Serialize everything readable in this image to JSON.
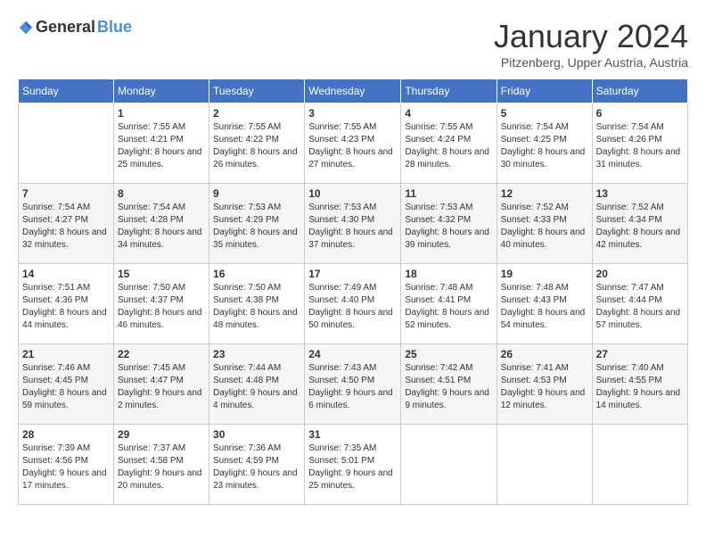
{
  "header": {
    "logo_general": "General",
    "logo_blue": "Blue",
    "month_year": "January 2024",
    "location": "Pitzenberg, Upper Austria, Austria"
  },
  "weekdays": [
    "Sunday",
    "Monday",
    "Tuesday",
    "Wednesday",
    "Thursday",
    "Friday",
    "Saturday"
  ],
  "weeks": [
    [
      {
        "day": "",
        "sunrise": "",
        "sunset": "",
        "daylight": ""
      },
      {
        "day": "1",
        "sunrise": "Sunrise: 7:55 AM",
        "sunset": "Sunset: 4:21 PM",
        "daylight": "Daylight: 8 hours and 25 minutes."
      },
      {
        "day": "2",
        "sunrise": "Sunrise: 7:55 AM",
        "sunset": "Sunset: 4:22 PM",
        "daylight": "Daylight: 8 hours and 26 minutes."
      },
      {
        "day": "3",
        "sunrise": "Sunrise: 7:55 AM",
        "sunset": "Sunset: 4:23 PM",
        "daylight": "Daylight: 8 hours and 27 minutes."
      },
      {
        "day": "4",
        "sunrise": "Sunrise: 7:55 AM",
        "sunset": "Sunset: 4:24 PM",
        "daylight": "Daylight: 8 hours and 28 minutes."
      },
      {
        "day": "5",
        "sunrise": "Sunrise: 7:54 AM",
        "sunset": "Sunset: 4:25 PM",
        "daylight": "Daylight: 8 hours and 30 minutes."
      },
      {
        "day": "6",
        "sunrise": "Sunrise: 7:54 AM",
        "sunset": "Sunset: 4:26 PM",
        "daylight": "Daylight: 8 hours and 31 minutes."
      }
    ],
    [
      {
        "day": "7",
        "sunrise": "Sunrise: 7:54 AM",
        "sunset": "Sunset: 4:27 PM",
        "daylight": "Daylight: 8 hours and 32 minutes."
      },
      {
        "day": "8",
        "sunrise": "Sunrise: 7:54 AM",
        "sunset": "Sunset: 4:28 PM",
        "daylight": "Daylight: 8 hours and 34 minutes."
      },
      {
        "day": "9",
        "sunrise": "Sunrise: 7:53 AM",
        "sunset": "Sunset: 4:29 PM",
        "daylight": "Daylight: 8 hours and 35 minutes."
      },
      {
        "day": "10",
        "sunrise": "Sunrise: 7:53 AM",
        "sunset": "Sunset: 4:30 PM",
        "daylight": "Daylight: 8 hours and 37 minutes."
      },
      {
        "day": "11",
        "sunrise": "Sunrise: 7:53 AM",
        "sunset": "Sunset: 4:32 PM",
        "daylight": "Daylight: 8 hours and 39 minutes."
      },
      {
        "day": "12",
        "sunrise": "Sunrise: 7:52 AM",
        "sunset": "Sunset: 4:33 PM",
        "daylight": "Daylight: 8 hours and 40 minutes."
      },
      {
        "day": "13",
        "sunrise": "Sunrise: 7:52 AM",
        "sunset": "Sunset: 4:34 PM",
        "daylight": "Daylight: 8 hours and 42 minutes."
      }
    ],
    [
      {
        "day": "14",
        "sunrise": "Sunrise: 7:51 AM",
        "sunset": "Sunset: 4:36 PM",
        "daylight": "Daylight: 8 hours and 44 minutes."
      },
      {
        "day": "15",
        "sunrise": "Sunrise: 7:50 AM",
        "sunset": "Sunset: 4:37 PM",
        "daylight": "Daylight: 8 hours and 46 minutes."
      },
      {
        "day": "16",
        "sunrise": "Sunrise: 7:50 AM",
        "sunset": "Sunset: 4:38 PM",
        "daylight": "Daylight: 8 hours and 48 minutes."
      },
      {
        "day": "17",
        "sunrise": "Sunrise: 7:49 AM",
        "sunset": "Sunset: 4:40 PM",
        "daylight": "Daylight: 8 hours and 50 minutes."
      },
      {
        "day": "18",
        "sunrise": "Sunrise: 7:48 AM",
        "sunset": "Sunset: 4:41 PM",
        "daylight": "Daylight: 8 hours and 52 minutes."
      },
      {
        "day": "19",
        "sunrise": "Sunrise: 7:48 AM",
        "sunset": "Sunset: 4:43 PM",
        "daylight": "Daylight: 8 hours and 54 minutes."
      },
      {
        "day": "20",
        "sunrise": "Sunrise: 7:47 AM",
        "sunset": "Sunset: 4:44 PM",
        "daylight": "Daylight: 8 hours and 57 minutes."
      }
    ],
    [
      {
        "day": "21",
        "sunrise": "Sunrise: 7:46 AM",
        "sunset": "Sunset: 4:45 PM",
        "daylight": "Daylight: 8 hours and 59 minutes."
      },
      {
        "day": "22",
        "sunrise": "Sunrise: 7:45 AM",
        "sunset": "Sunset: 4:47 PM",
        "daylight": "Daylight: 9 hours and 2 minutes."
      },
      {
        "day": "23",
        "sunrise": "Sunrise: 7:44 AM",
        "sunset": "Sunset: 4:48 PM",
        "daylight": "Daylight: 9 hours and 4 minutes."
      },
      {
        "day": "24",
        "sunrise": "Sunrise: 7:43 AM",
        "sunset": "Sunset: 4:50 PM",
        "daylight": "Daylight: 9 hours and 6 minutes."
      },
      {
        "day": "25",
        "sunrise": "Sunrise: 7:42 AM",
        "sunset": "Sunset: 4:51 PM",
        "daylight": "Daylight: 9 hours and 9 minutes."
      },
      {
        "day": "26",
        "sunrise": "Sunrise: 7:41 AM",
        "sunset": "Sunset: 4:53 PM",
        "daylight": "Daylight: 9 hours and 12 minutes."
      },
      {
        "day": "27",
        "sunrise": "Sunrise: 7:40 AM",
        "sunset": "Sunset: 4:55 PM",
        "daylight": "Daylight: 9 hours and 14 minutes."
      }
    ],
    [
      {
        "day": "28",
        "sunrise": "Sunrise: 7:39 AM",
        "sunset": "Sunset: 4:56 PM",
        "daylight": "Daylight: 9 hours and 17 minutes."
      },
      {
        "day": "29",
        "sunrise": "Sunrise: 7:37 AM",
        "sunset": "Sunset: 4:58 PM",
        "daylight": "Daylight: 9 hours and 20 minutes."
      },
      {
        "day": "30",
        "sunrise": "Sunrise: 7:36 AM",
        "sunset": "Sunset: 4:59 PM",
        "daylight": "Daylight: 9 hours and 23 minutes."
      },
      {
        "day": "31",
        "sunrise": "Sunrise: 7:35 AM",
        "sunset": "Sunset: 5:01 PM",
        "daylight": "Daylight: 9 hours and 25 minutes."
      },
      {
        "day": "",
        "sunrise": "",
        "sunset": "",
        "daylight": ""
      },
      {
        "day": "",
        "sunrise": "",
        "sunset": "",
        "daylight": ""
      },
      {
        "day": "",
        "sunrise": "",
        "sunset": "",
        "daylight": ""
      }
    ]
  ]
}
